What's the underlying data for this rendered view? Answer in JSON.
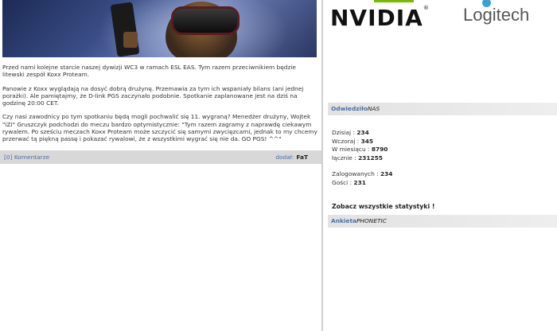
{
  "article": {
    "paragraphs": [
      "Przed nami kolejne starcie naszej dywizji WC3 w ramach ESL EAS. Tym razem przeciwnikiem będzie litewski zespół Koxx Proteam.",
      "Panowie z Koxx wyglądają na dosyć dobrą drużynę. Przemawia za tym ich wspaniały bilans (ani jednej porażki). Ale pamiętajmy, że D-link PGS zaczynało podobnie. Spotkanie zaplanowane jest na dziś na godzinę 20:00 CET.",
      "Czy nasi zawodnicy po tym spotkaniu będą mogli pochwalić się 11. wygraną? Menedżer drużyny, Wojtek \"iZi\" Gruszczyk podchodzi do meczu bardzo optymistycznie: \"Tym razem zagramy z naprawdę ciekawym rywalem. Po sześciu meczach Koxx Proteam może szczycić się samymi zwycięzcami, jednak to my chcemy przerwać tą piękną passę i pokazać rywalowi, że z wszystkimi wygrać się nie da. GO PGS! ^^\""
    ],
    "comments_link": "[0] Komentarze",
    "author_label": "dodał:",
    "author_name": "FaT"
  },
  "sponsors": {
    "nvidia": "NVIDIA",
    "nvidia_reg": "®",
    "logitech": "Logitech",
    "nvidia_color": "#76b900",
    "logitech_color": "#3aa0d8"
  },
  "visitors": {
    "header_a": "Odwiedziło",
    "header_b": "NAS",
    "today_label": "Dzisiaj :",
    "today": "234",
    "yesterday_label": "Wczoraj :",
    "yesterday": "345",
    "month_label": "W miesiącu :",
    "month": "8790",
    "total_label": "łącznie :",
    "total": "231255",
    "logged_label": "Zalogowanych :",
    "logged": "234",
    "guests_label": "Gości :",
    "guests": "231",
    "full_stats": "Zobacz wszystkie statystyki !"
  },
  "poll": {
    "header_a": "Ankieta",
    "header_b": "PHONETIC"
  }
}
